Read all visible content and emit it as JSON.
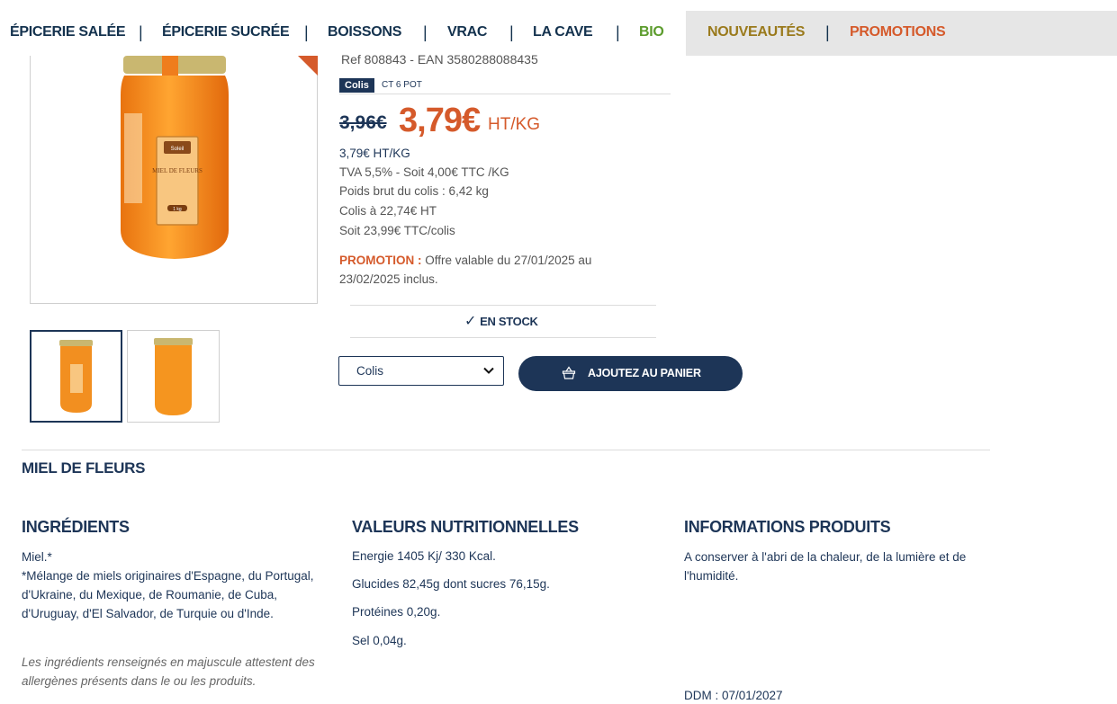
{
  "nav": {
    "items": [
      {
        "label": "ÉPICERIE SALÉE",
        "color": "#14324e"
      },
      {
        "label": "ÉPICERIE SUCRÉE",
        "color": "#14324e"
      },
      {
        "label": "BOISSONS",
        "color": "#14324e"
      },
      {
        "label": "VRAC",
        "color": "#14324e"
      },
      {
        "label": "LA CAVE",
        "color": "#14324e"
      },
      {
        "label": "BIO",
        "color": "#5c9c2d"
      },
      {
        "label": "NOUVEAUTÉS",
        "color": "#9a7a1c"
      },
      {
        "label": "PROMOTIONS",
        "color": "#d55a2b"
      }
    ],
    "separator": "|"
  },
  "product": {
    "ref_line": "Ref 808843 - EAN 3580288088435",
    "colis_badge": "Colis",
    "colis_type": "CT 6 POT",
    "old_price": "3,96€",
    "new_price": "3,79€",
    "price_unit": "HT/KG",
    "price_line": "3,79€ HT/KG",
    "tva_line": "TVA 5,5% - Soit 4,00€ TTC /KG",
    "weight_line": "Poids brut du colis : 6,42 kg",
    "colis_price_line": "Colis à 22,74€ HT",
    "colis_ttc_line": "Soit 23,99€ TTC/colis",
    "promo_label": "PROMOTION :",
    "promo_text": " Offre valable du 27/01/2025 au 23/02/2025 inclus.",
    "stock_check": "✓",
    "stock_label": "EN STOCK",
    "select_value": "Colis",
    "cart_label": "AJOUTEZ AU PANIER",
    "title": "MIEL DE FLEURS",
    "jar_brand": "Soleil",
    "jar_name": "MIEL DE FLEURS",
    "jar_weight": "1 kg"
  },
  "sections": {
    "ingredients": {
      "title": "INGRÉDIENTS",
      "line1": "Miel.*",
      "text": "*Mélange de miels originaires d'Espagne, du Portugal, d'Ukraine, du Mexique, de Roumanie, de Cuba, d'Uruguay, d'El Salvador, de Turquie ou d'Inde.",
      "note": "Les ingrédients renseignés en majuscule attestent des allergènes présents dans le ou les produits."
    },
    "nutrition": {
      "title": "VALEURS NUTRITIONNELLES",
      "lines": [
        "Energie 1405 Kj/ 330 Kcal.",
        "Glucides 82,45g dont sucres 76,15g.",
        "Protéines 0,20g.",
        "Sel 0,04g."
      ]
    },
    "info": {
      "title": "INFORMATIONS PRODUITS",
      "text": "A conserver à l'abri de la chaleur, de la lumière et de l'humidité.",
      "ddm": "DDM : 07/01/2027"
    }
  },
  "colors": {
    "navy": "#1d3557",
    "accent_orange": "#d55a2b",
    "bio_green": "#5c9c2d",
    "nouveautes_gold": "#9a7a1c",
    "nav_bg_grey": "#e6e6e6"
  },
  "icons": [
    "check-icon",
    "chevron-down-icon",
    "basket-icon",
    "honey-jar-image"
  ]
}
